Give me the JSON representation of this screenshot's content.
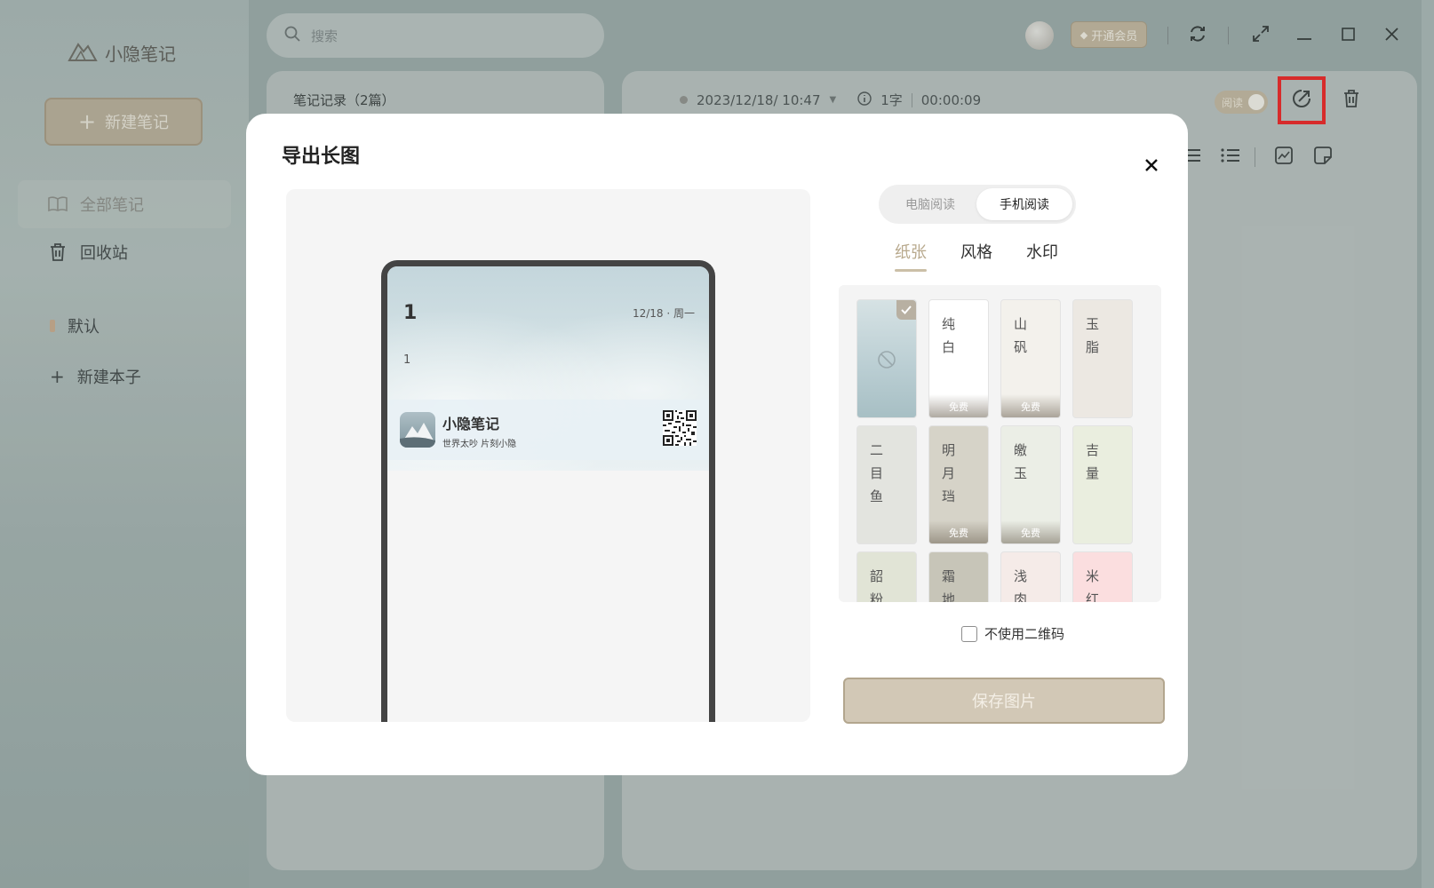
{
  "app": {
    "name": "小隐笔记"
  },
  "sidebar": {
    "new_note": "新建笔记",
    "items": [
      {
        "label": "全部笔记"
      },
      {
        "label": "回收站"
      }
    ],
    "notebooks": [
      {
        "label": "默认"
      }
    ],
    "new_notebook": "新建本子"
  },
  "search": {
    "placeholder": "搜索"
  },
  "list": {
    "title": "笔记记录（2篇）"
  },
  "editor": {
    "datetime": "2023/12/18/ 10:47",
    "word_count": "1字",
    "duration": "00:00:09",
    "read_label": "阅读"
  },
  "topbar": {
    "vip_label": "开通会员"
  },
  "modal": {
    "title": "导出长图",
    "modes": [
      {
        "label": "电脑阅读"
      },
      {
        "label": "手机阅读"
      }
    ],
    "active_mode": "手机阅读",
    "tabs": [
      {
        "label": "纸张"
      },
      {
        "label": "风格"
      },
      {
        "label": "水印"
      }
    ],
    "active_tab": "纸张",
    "preview": {
      "title": "1",
      "date": "12/18 · 周一",
      "body": "1",
      "app_name": "小隐笔记",
      "slogan": "世界太吵 片刻小隐"
    },
    "papers": [
      {
        "name": "",
        "color": "#c9d8dc",
        "free": false,
        "selected": true
      },
      {
        "name": "纯白",
        "color": "#ffffff",
        "free": true
      },
      {
        "name": "山矾",
        "color": "#f3f1ec",
        "free": true
      },
      {
        "name": "玉脂",
        "color": "#ece8e2",
        "free": false
      },
      {
        "name": "二目鱼",
        "color": "#e3e4df",
        "free": false
      },
      {
        "name": "明月珰",
        "color": "#d6d3c8",
        "free": true
      },
      {
        "name": "皦玉",
        "color": "#ebeee6",
        "free": true
      },
      {
        "name": "吉量",
        "color": "#eaeedf",
        "free": false
      },
      {
        "name": "韶粉",
        "color": "#e1e4d6",
        "free": false
      },
      {
        "name": "霜地",
        "color": "#c7c5b8",
        "free": false
      },
      {
        "name": "浅肉",
        "color": "#f5ebe8",
        "free": false
      },
      {
        "name": "米红",
        "color": "#fbdedf",
        "free": false
      }
    ],
    "free_label": "免费",
    "no_qr_label": "不使用二维码",
    "save_label": "保存图片"
  }
}
